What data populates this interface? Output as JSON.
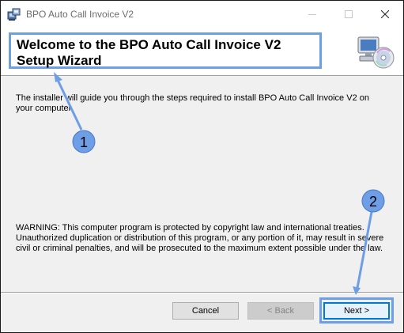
{
  "window": {
    "title": "BPO Auto Call Invoice V2"
  },
  "header": {
    "wizard_title": "Welcome to the BPO Auto Call Invoice V2 Setup Wizard",
    "icon": "installer-cd-computer-icon"
  },
  "body": {
    "intro": "The installer will guide you through the steps required to install BPO Auto Call Invoice V2 on your computer.",
    "warning": "WARNING: This computer program is protected by copyright law and international treaties. Unauthorized duplication or distribution of this program, or any portion of it, may result in severe civil or criminal penalties, and will be prosecuted to the maximum extent possible under the law."
  },
  "buttons": {
    "cancel": "Cancel",
    "back": "< Back",
    "next": "Next >"
  },
  "annotations": {
    "badge_1": "1",
    "badge_2": "2",
    "color": "#6e9ee6"
  }
}
